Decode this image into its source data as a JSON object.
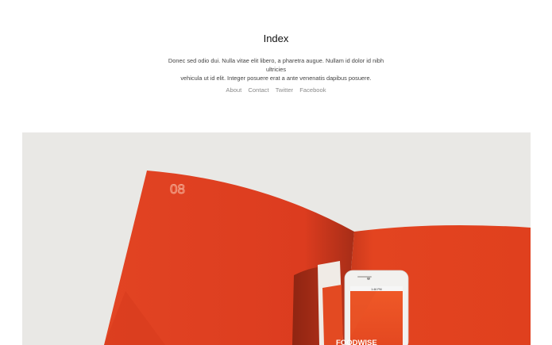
{
  "header": {
    "title": "Index",
    "description_line1": "Donec sed odio dui. Nulla vitae elit libero, a pharetra augue. Nullam id dolor id nibh ultricies",
    "description_line2": "vehicula ut id elit. Integer posuere erat a ante venenatis dapibus posuere."
  },
  "nav": {
    "items": [
      {
        "label": "About"
      },
      {
        "label": "Contact"
      },
      {
        "label": "Twitter"
      },
      {
        "label": "Facebook"
      }
    ]
  },
  "hero": {
    "page_number": "08",
    "phone_status": "1:46 PM",
    "brand_text": "FOODWISE",
    "colors": {
      "background": "#e9e8e5",
      "orange": "#e2401f",
      "orange_dark": "#b8331a"
    }
  }
}
